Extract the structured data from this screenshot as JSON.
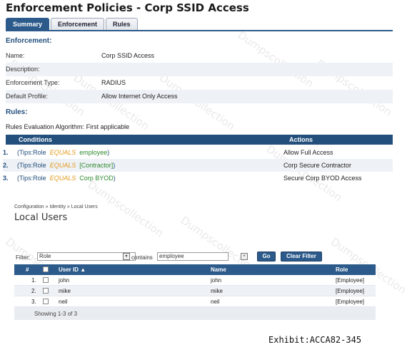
{
  "page_title": "Enforcement Policies - Corp SSID Access",
  "tabs": [
    {
      "label": "Summary",
      "active": true
    },
    {
      "label": "Enforcement",
      "active": false
    },
    {
      "label": "Rules",
      "active": false
    }
  ],
  "enforcement": {
    "heading": "Enforcement:",
    "fields": [
      {
        "label": "Name:",
        "value": "Corp SSID Access"
      },
      {
        "label": "Description:",
        "value": ""
      },
      {
        "label": "Enforcement Type:",
        "value": "RADIUS"
      },
      {
        "label": "Default Profile:",
        "value": "Allow Internet Only Access"
      }
    ]
  },
  "rules": {
    "heading": "Rules:",
    "algorithm_label": "Rules Evaluation Algorithm:",
    "algorithm_value": "First applicable",
    "col_conditions": "Conditions",
    "col_actions": "Actions",
    "rows": [
      {
        "num": "1.",
        "open": "(",
        "attr": "Tips:Role",
        "op": "EQUALS",
        "value": "employee",
        "close": ")",
        "action": "Allow Full Access"
      },
      {
        "num": "2.",
        "open": "(",
        "attr": "Tips:Role",
        "op": "EQUALS",
        "value": "[Contractor]",
        "close": ")",
        "action": "Corp Secure Contractor"
      },
      {
        "num": "3.",
        "open": "(",
        "attr": "Tips:Role",
        "op": "EQUALS",
        "value": "Corp BYOD",
        "close": ")",
        "action": "Secure Corp BYOD Access"
      }
    ]
  },
  "breadcrumb": "Configuration » Identity » Local Users",
  "local_users": {
    "title": "Local Users",
    "filter_label": "Filter:",
    "filter_field": "Role",
    "filter_op": "contains",
    "filter_value": "employee",
    "add_symbol": "+",
    "go_label": "Go",
    "clear_label": "Clear Filter",
    "columns": {
      "num": "#",
      "userid": "User ID ▲",
      "name": "Name",
      "role": "Role"
    },
    "rows": [
      {
        "num": "1.",
        "userid": "john",
        "name": "john",
        "role": "[Employee]"
      },
      {
        "num": "2.",
        "userid": "mike",
        "name": "mike",
        "role": "[Employee]"
      },
      {
        "num": "3.",
        "userid": "neil",
        "name": "neil",
        "role": "[Employee]"
      }
    ],
    "footer": "Showing 1-3 of 3"
  },
  "exhibit_label": "Exhibit:ACCA82-345",
  "watermark_text": "Dumpscollection",
  "colors": {
    "accent": "#234f7c",
    "operator": "#e39a1c",
    "value": "#2f8a2f"
  }
}
